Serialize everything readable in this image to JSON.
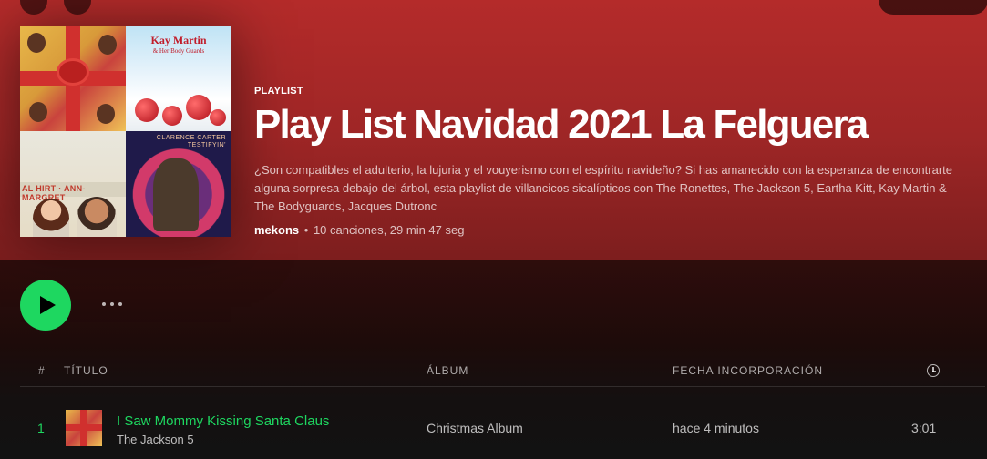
{
  "playlist": {
    "kind": "PLAYLIST",
    "title": "Play List Navidad 2021 La Felguera",
    "description": "¿Son compatibles el adulterio, la lujuria y el vouyerismo con el espíritu navideño? Si has amanecido con la esperanza de encontrarte alguna sorpresa debajo del árbol, esta playlist de villancicos sicalípticos con The Ronettes, The Jackson 5, Eartha Kitt, Kay Martin & The Bodyguards, Jacques Dutronc",
    "owner": "mekons",
    "separator": "•",
    "stats": "10 canciones, 29 min 47 seg"
  },
  "cover": {
    "tile2_title": "Kay Martin",
    "tile2_subtitle": "& Her Body Guards",
    "tile3_title": "AL HIRT · ANN-MARGRET",
    "tile4_title": "CLARENCE CARTER\nTESTIFYIN'"
  },
  "table": {
    "headers": {
      "num": "#",
      "title": "TÍTULO",
      "album": "ÁLBUM",
      "added": "FECHA INCORPORACIÓN"
    },
    "rows": [
      {
        "num": "1",
        "title": "I Saw Mommy Kissing Santa Claus",
        "artist": "The Jackson 5",
        "album": "Christmas Album",
        "added": "hace 4 minutos",
        "duration": "3:01"
      }
    ]
  },
  "colors": {
    "accent": "#1ed760",
    "header_bg": "#a42828"
  },
  "icons": {
    "play": "play-icon",
    "more": "more-options-icon",
    "clock": "clock-icon"
  }
}
